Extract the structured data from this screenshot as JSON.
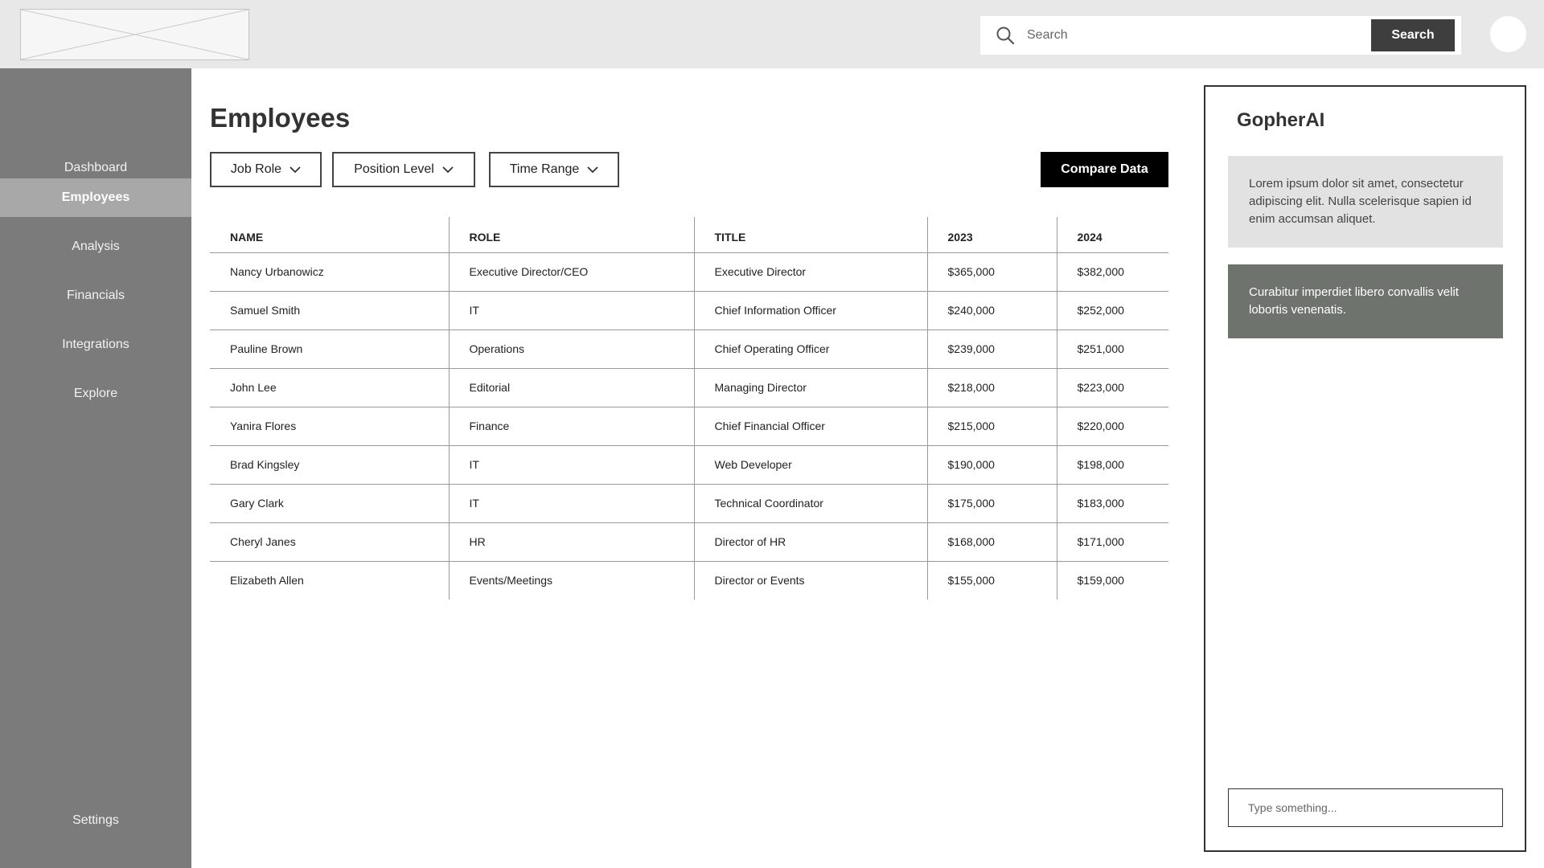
{
  "header": {
    "search": {
      "placeholder": "Search",
      "value": "",
      "button_label": "Search",
      "icon": "search-icon"
    }
  },
  "sidebar": {
    "items": [
      {
        "label": "Dashboard",
        "active": false
      },
      {
        "label": "Employees",
        "active": true
      },
      {
        "label": "Analysis",
        "active": false
      },
      {
        "label": "Financials",
        "active": false
      },
      {
        "label": "Integrations",
        "active": false
      },
      {
        "label": "Explore",
        "active": false
      }
    ],
    "settings_label": "Settings"
  },
  "main": {
    "title": "Employees",
    "filters": [
      {
        "label": "Job Role",
        "icon": "chevron-down-icon"
      },
      {
        "label": "Position Level",
        "icon": "chevron-down-icon"
      },
      {
        "label": "Time Range",
        "icon": "chevron-down-icon"
      }
    ],
    "compare_label": "Compare Data",
    "table": {
      "columns": [
        "NAME",
        "ROLE",
        "TITLE",
        "2023",
        "2024"
      ],
      "rows": [
        [
          "Nancy Urbanowicz",
          "Executive Director/CEO",
          "Executive Director",
          "$365,000",
          "$382,000"
        ],
        [
          "Samuel Smith",
          "IT",
          "Chief Information Officer",
          "$240,000",
          "$252,000"
        ],
        [
          "Pauline Brown",
          "Operations",
          "Chief Operating Officer",
          "$239,000",
          "$251,000"
        ],
        [
          "John Lee",
          "Editorial",
          "Managing Director",
          "$218,000",
          "$223,000"
        ],
        [
          "Yanira Flores",
          "Finance",
          "Chief Financial Officer",
          "$215,000",
          "$220,000"
        ],
        [
          "Brad Kingsley",
          "IT",
          "Web Developer",
          "$190,000",
          "$198,000"
        ],
        [
          "Gary Clark",
          "IT",
          "Technical Coordinator",
          "$175,000",
          "$183,000"
        ],
        [
          "Cheryl Janes",
          "HR",
          "Director of HR",
          "$168,000",
          "$171,000"
        ],
        [
          "Elizabeth Allen",
          "Events/Meetings",
          "Director or Events",
          "$155,000",
          "$159,000"
        ]
      ]
    }
  },
  "ai_panel": {
    "title": "GopherAI",
    "messages": [
      "Lorem ipsum dolor sit amet, consectetur adipiscing elit. Nulla scelerisque sapien id enim accumsan aliquet.",
      "Curabitur imperdiet libero convallis velit lobortis venenatis."
    ],
    "input_placeholder": "Type something..."
  },
  "colors": {
    "topbar": "#e8e8e8",
    "sidebar": "#7b7b7b",
    "sidebar_active": "#a8a8a8",
    "primary_button": "#000000",
    "search_button": "#3e3e3e",
    "ai_message_light": "#e2e2e2",
    "ai_message_dark": "#6f736e"
  }
}
